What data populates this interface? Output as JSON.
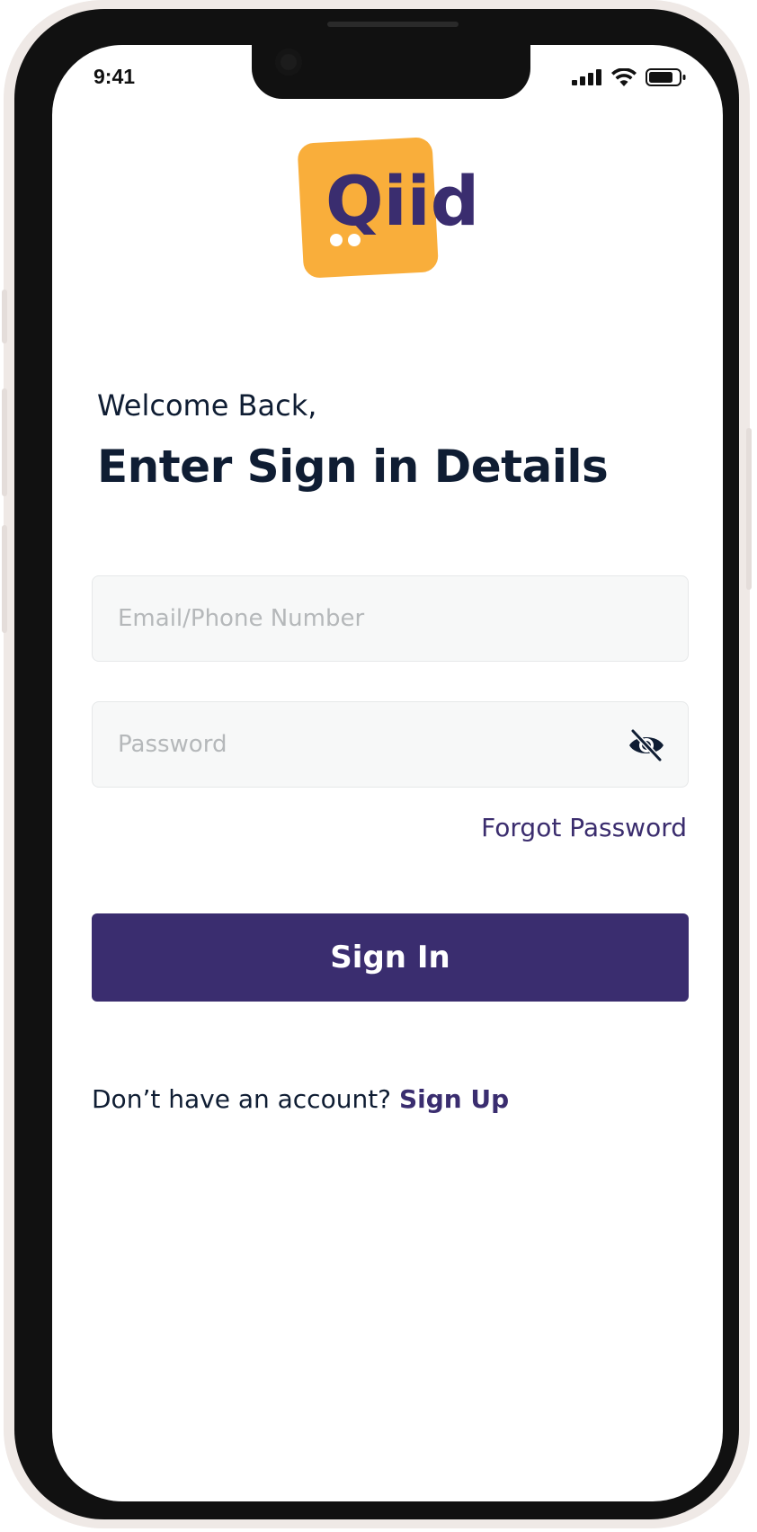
{
  "status_bar": {
    "time": "9:41",
    "icons": [
      "signal-icon",
      "wifi-icon",
      "battery-icon"
    ]
  },
  "brand": {
    "logo_text": "Qiid",
    "logo_bg_color": "#F9AE3B",
    "logo_text_color": "#3A2D6F"
  },
  "header": {
    "welcome": "Welcome Back,",
    "title": "Enter Sign in Details"
  },
  "form": {
    "email_placeholder": "Email/Phone Number",
    "email_value": "",
    "password_placeholder": "Password",
    "password_value": "",
    "password_toggle_icon": "eye-off-icon",
    "forgot_label": "Forgot Password",
    "submit_label": "Sign In"
  },
  "footer": {
    "prompt": "Don’t have an account?",
    "signup_label": "Sign Up"
  },
  "colors": {
    "primary": "#3A2D6F",
    "heading": "#0F1D33",
    "input_bg": "#F7F8F8"
  }
}
